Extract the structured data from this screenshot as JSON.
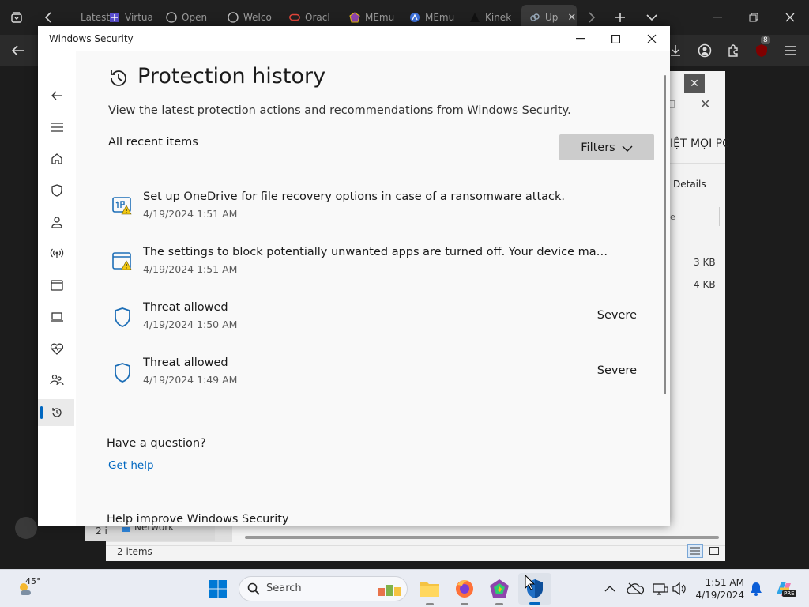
{
  "browser": {
    "tabs": [
      "Latest",
      "Virtua",
      "Open",
      "Welco",
      "Oracl",
      "MEmu",
      "MEmu",
      "Kinek",
      "Up"
    ],
    "ext_badge": "8"
  },
  "background_explorer": {
    "header_text": "IỆT MỌI PC",
    "details_label": "Details",
    "col_fragment": "e",
    "file_sizes": [
      "3 KB",
      "4 KB"
    ],
    "nav_network": "Network",
    "nav_prefix": "2 i",
    "status": "2 items"
  },
  "ws": {
    "window_title": "Windows Security",
    "page_title": "Protection history",
    "description": "View the latest protection actions and recommendations from Windows Security.",
    "section_label": "All recent items",
    "filters_label": "Filters",
    "items": [
      {
        "title": "Set up OneDrive for file recovery options in case of a ransomware attack.",
        "date": "4/19/2024 1:51 AM",
        "severity": ""
      },
      {
        "title": "The settings to block potentially unwanted apps are turned off. Your device may be vu...",
        "date": "4/19/2024 1:51 AM",
        "severity": ""
      },
      {
        "title": "Threat allowed",
        "date": "4/19/2024 1:50 AM",
        "severity": "Severe"
      },
      {
        "title": "Threat allowed",
        "date": "4/19/2024 1:49 AM",
        "severity": "Severe"
      }
    ],
    "question_heading": "Have a question?",
    "get_help": "Get help",
    "improve_heading": "Help improve Windows Security"
  },
  "taskbar": {
    "weather_temp": "45°",
    "search_placeholder": "Search",
    "time": "1:51 AM",
    "date": "4/19/2024",
    "copilot_badge": "PRE"
  },
  "colors": {
    "accent": "#0067c0",
    "shield": "#1e6fb7",
    "warning": "#f2c811"
  }
}
